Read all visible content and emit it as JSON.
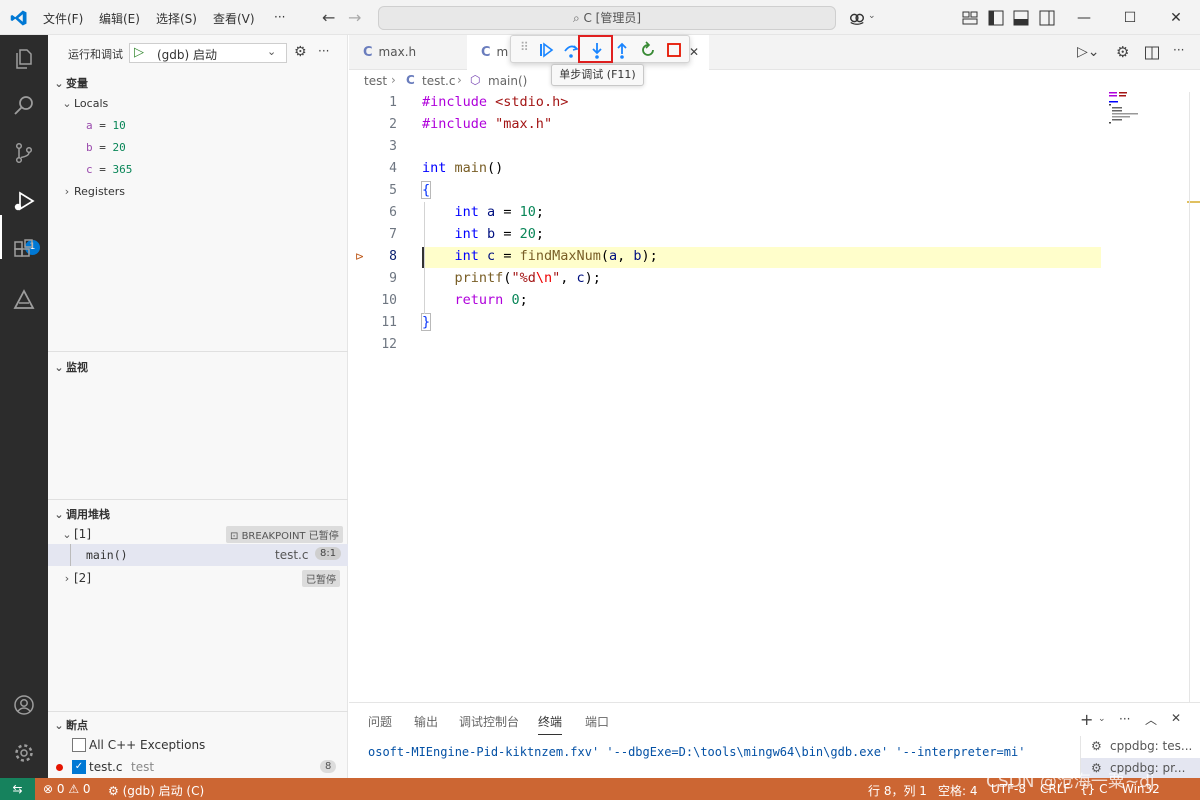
{
  "titlebar": {
    "menus": [
      "文件(F)",
      "编辑(E)",
      "选择(S)",
      "查看(V)",
      "···"
    ],
    "command_center": "C [管理员]"
  },
  "activitybar": {
    "items": [
      "explorer-icon",
      "search-icon",
      "source-control-icon",
      "run-debug-icon",
      "extensions-icon",
      "testing-icon"
    ],
    "debug_badge": "1"
  },
  "sidebar": {
    "run_label": "运行和调试",
    "config": "(gdb) 启动",
    "variables_title": "变量",
    "locals_label": "Locals",
    "locals": [
      {
        "name": "a",
        "value": "10"
      },
      {
        "name": "b",
        "value": "20"
      },
      {
        "name": "c",
        "value": "365"
      }
    ],
    "registers_label": "Registers",
    "watch_title": "监视",
    "callstack_title": "调用堆栈",
    "thread1": {
      "label": "[1]",
      "badge": "BREAKPOINT 已暂停"
    },
    "frame": {
      "name": "main()",
      "file": "test.c",
      "pos": "8:1"
    },
    "thread2": {
      "label": "[2]",
      "badge": "已暂停"
    },
    "breakpoints_title": "断点",
    "bp_exceptions": "All C++ Exceptions",
    "bp_file": {
      "name": "test.c",
      "dir": "test",
      "line": "8"
    }
  },
  "tabs": [
    {
      "label": "max.h"
    },
    {
      "label": "m"
    }
  ],
  "breadcrumb": {
    "folder": "test",
    "file": "test.c",
    "symbol": "main()"
  },
  "debug_toolbar": {
    "tooltip": "单步调试 (F11)"
  },
  "code": {
    "line_numbers": [
      "1",
      "2",
      "3",
      "4",
      "5",
      "6",
      "7",
      "8",
      "9",
      "10",
      "11",
      "12"
    ],
    "current_line": 8
  },
  "panel": {
    "tabs": [
      "问题",
      "输出",
      "调试控制台",
      "终端",
      "端口"
    ],
    "active_tab": "终端",
    "terminal_line": "osoft-MIEngine-Pid-kiktnzem.fxv' '--dbgExe=D:\\tools\\mingw64\\bin\\gdb.exe' '--interpreter=mi'",
    "terminals": [
      "cppdbg: tes...",
      "cppdbg: pr..."
    ]
  },
  "statusbar": {
    "errors": "0",
    "warnings": "0",
    "debug_config": "(gdb) 启动 (C)",
    "position": "行 8，列 1",
    "indent": "空格: 4",
    "encoding": "UTF-8",
    "eol": "CRLF",
    "language": "{} C",
    "platform": "Win32"
  },
  "watermark": "CSDN @沧海一粟~dj",
  "colors": {
    "statusbar": "#cc6633",
    "activitybar": "#2c2c2c",
    "current_line": "#fffecb",
    "accent": "#0078d4"
  }
}
